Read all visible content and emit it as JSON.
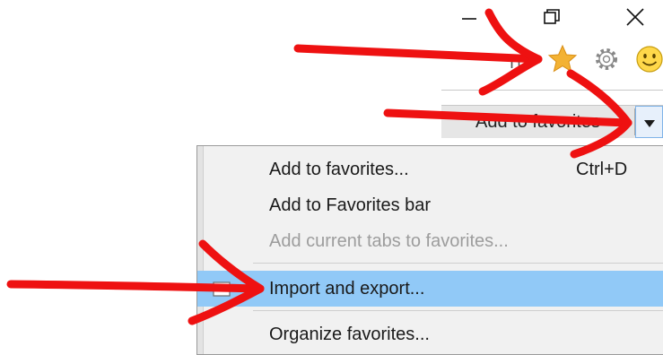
{
  "window": {
    "minimize_glyph": "—",
    "restore_glyph": "❐",
    "close_glyph": "✕"
  },
  "toolbar": {
    "cut_text": "Tı",
    "icons": [
      "favorites-star-icon",
      "settings-gear-icon",
      "feedback-smiley-icon"
    ],
    "star_color": "#f3b233"
  },
  "favorites_bar": {
    "button_label": "Add to favorites"
  },
  "menu": {
    "items": [
      {
        "label": "Add to favorites...",
        "shortcut": "Ctrl+D",
        "enabled": true
      },
      {
        "label": "Add to Favorites bar",
        "enabled": true
      },
      {
        "label": "Add current tabs to favorites...",
        "enabled": false
      },
      {
        "label": "Import and export...",
        "enabled": true,
        "highlighted": true
      },
      {
        "label": "Organize favorites...",
        "enabled": true
      }
    ],
    "highlight_color": "#91c9f7"
  },
  "annotation_color": "#ee1111"
}
